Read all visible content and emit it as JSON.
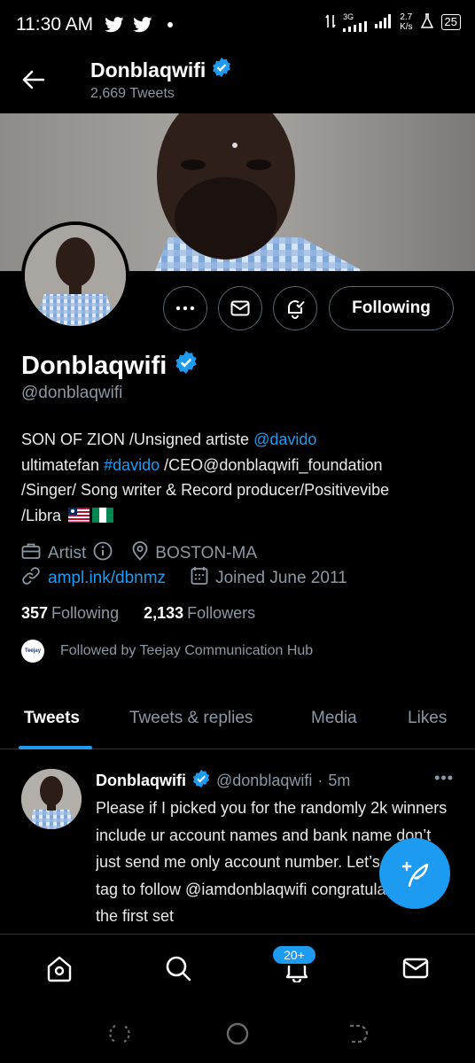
{
  "status_bar": {
    "time": "11:30 AM",
    "network": "3G",
    "speed": "2.7",
    "speed_unit": "K/s",
    "battery": "25"
  },
  "header": {
    "name": "Donblaqwifi",
    "tweet_count": "2,669 Tweets"
  },
  "profile": {
    "name": "Donblaqwifi",
    "handle": "@donblaqwifi",
    "following_button": "Following",
    "bio": {
      "line1_text": "SON OF ZION /Unsigned artiste ",
      "line1_link": "@davido",
      "line2_text": "ultimatefan ",
      "line2_link": "#davido",
      "line2_rest": " /CEO@donblaqwifi_foundation",
      "line3": "/Singer/ Song writer & Record producer/Positivevibe",
      "line4": "/Libra"
    },
    "profession": "Artist",
    "location": "BOSTON-MA",
    "website": "ampl.ink/dbnmz",
    "joined": "Joined June 2011",
    "following_count": "357",
    "following_label": "Following",
    "followers_count": "2,133",
    "followers_label": "Followers",
    "followed_by": "Followed by Teejay Communication Hub",
    "followed_by_avatar_text": "Teejay"
  },
  "tabs": [
    {
      "label": "Tweets",
      "active": true
    },
    {
      "label": "Tweets & replies",
      "active": false
    },
    {
      "label": "Media",
      "active": false
    },
    {
      "label": "Likes",
      "active": false
    }
  ],
  "tweet": {
    "name": "Donblaqwifi",
    "handle": "@donblaqwifi",
    "separator": "·",
    "time": "5m",
    "more": "•••",
    "text": "Please if I picked you  for the randomly 2k winners include ur account names and bank name don’t just send me only account number. Let’s go guys tag  to follow @iamdonblaqwifi congratulations to the first set"
  },
  "bottom_nav": {
    "items": [
      "home-icon",
      "search-icon",
      "notifications-icon",
      "messages-icon"
    ],
    "notification_badge": "20+"
  },
  "colors": {
    "accent": "#1d9bf0",
    "background": "#000000",
    "secondary_text": "#8b98a5"
  }
}
